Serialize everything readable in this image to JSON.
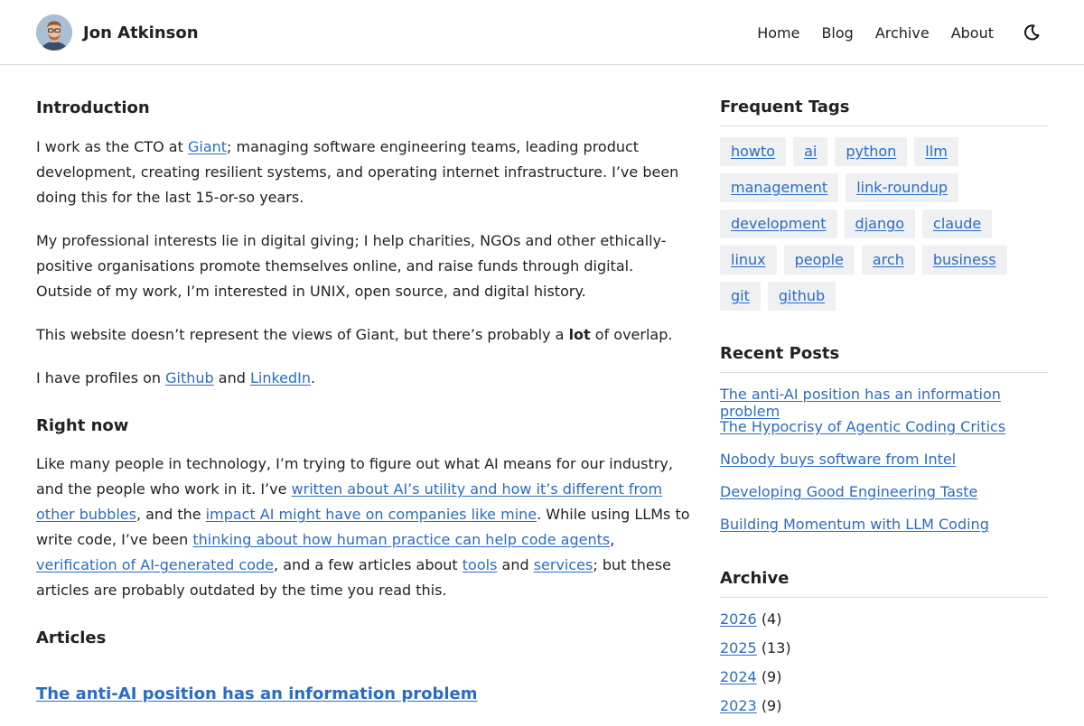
{
  "header": {
    "site_name": "Jon Atkinson",
    "nav": [
      "Home",
      "Blog",
      "Archive",
      "About"
    ],
    "theme_icon": "moon-icon"
  },
  "main": {
    "intro_heading": "Introduction",
    "p1": {
      "before": "I work as the CTO at ",
      "link": "Giant",
      "after": "; managing software engineering teams, leading product development, creating resilient systems, and operating internet infrastructure. I’ve been doing this for the last 15-or-so years."
    },
    "p2": "My professional interests lie in digital giving; I help charities, NGOs and other ethically-positive organisations promote themselves online, and raise funds through digital. Outside of my work, I’m interested in UNIX, open source, and digital history.",
    "p3": {
      "before": "This website doesn’t represent the views of Giant, but there’s probably a ",
      "bold": "lot",
      "after": " of overlap."
    },
    "p4": {
      "before": "I have profiles on ",
      "link1": "Github",
      "mid": " and ",
      "link2": "LinkedIn",
      "after": "."
    },
    "now_heading": "Right now",
    "p5": {
      "t1": "Like many people in technology, I’m trying to figure out what AI means for our industry, and the people who work in it. I’ve ",
      "l1": "written about AI’s utility and how it’s different from other bubbles",
      "t2": ", and the ",
      "l2": "impact AI might have on companies like mine",
      "t3": ". While using LLMs to write code, I’ve been ",
      "l3": "thinking about how human practice can help code agents",
      "t4": ", ",
      "l4": "verification of AI-generated code",
      "t5": ", and a few articles about ",
      "l5": "tools",
      "t6": " and ",
      "l6": "services",
      "t7": "; but these articles are probably outdated by the time you read this."
    },
    "articles_heading": "Articles",
    "first_article": "The anti-AI position has an information problem"
  },
  "sidebar": {
    "tags_heading": "Frequent Tags",
    "tags": [
      "howto",
      "ai",
      "python",
      "llm",
      "management",
      "link-roundup",
      "development",
      "django",
      "claude",
      "linux",
      "people",
      "arch",
      "business",
      "git",
      "github"
    ],
    "recent_heading": "Recent Posts",
    "recent": [
      "The anti-AI position has an information problem",
      "The Hypocrisy of Agentic Coding Critics",
      "Nobody buys software from Intel",
      "Developing Good Engineering Taste",
      "Building Momentum with LLM Coding"
    ],
    "archive_heading": "Archive",
    "archive": [
      {
        "year": "2026",
        "count": "(4)"
      },
      {
        "year": "2025",
        "count": "(13)"
      },
      {
        "year": "2024",
        "count": "(9)"
      },
      {
        "year": "2023",
        "count": "(9)"
      }
    ]
  }
}
